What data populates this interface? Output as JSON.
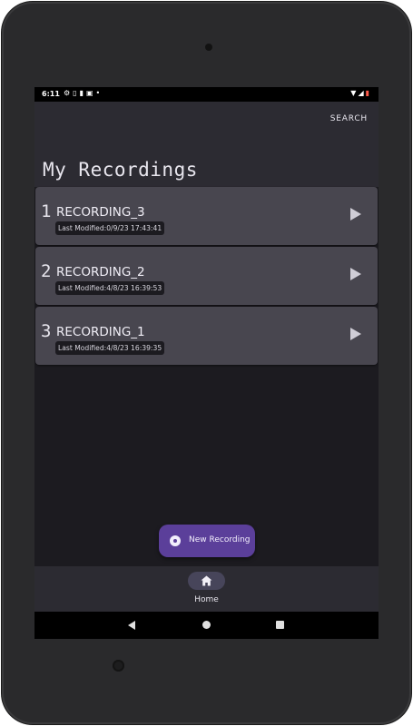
{
  "status_bar": {
    "time": "6:11",
    "left_icons": [
      "gear-icon",
      "vibrate-icon",
      "battery-saver-icon",
      "sim-icon",
      "dot-icon"
    ],
    "right_icons": [
      "wifi-icon",
      "signal-icon",
      "battery-icon"
    ]
  },
  "header": {
    "search_label": "SEARCH",
    "title": "My Recordings"
  },
  "recordings": [
    {
      "number": "1",
      "name": "RECORDING_3",
      "modified": "Last Modified:0/9/23 17:43:41"
    },
    {
      "number": "2",
      "name": "RECORDING_2",
      "modified": "Last Modified:4/8/23 16:39:53"
    },
    {
      "number": "3",
      "name": "RECORDING_1",
      "modified": "Last Modified:4/8/23 16:39:35"
    }
  ],
  "fab": {
    "label": "New Recording",
    "icon": "record-icon"
  },
  "bottom_nav": {
    "items": [
      {
        "label": "Home",
        "icon": "home-icon"
      }
    ]
  },
  "system_nav": {
    "buttons": [
      "back-icon",
      "home-circle-icon",
      "recents-icon"
    ]
  },
  "colors": {
    "accent": "#5b3f9a",
    "background": "#1c1b20",
    "surface": "#2c2b32",
    "card": "#48464f"
  }
}
